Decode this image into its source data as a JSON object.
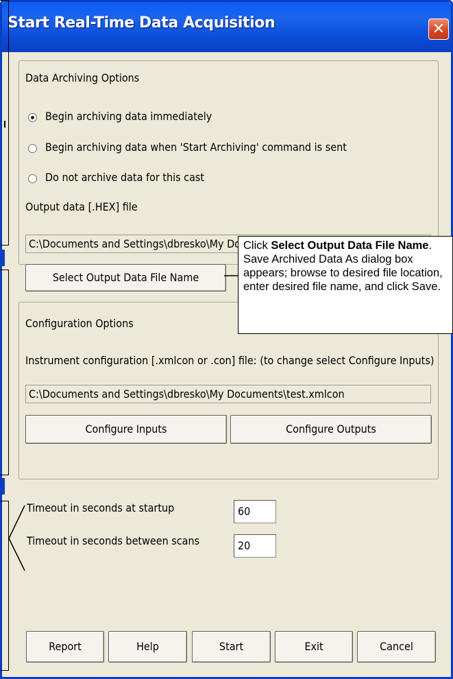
{
  "window": {
    "title": "Start Real-Time Data Acquisition",
    "close_icon": "close-icon"
  },
  "archiving": {
    "group_label": "Data Archiving Options",
    "options": [
      {
        "label": "Begin archiving data immediately",
        "selected": true
      },
      {
        "label": "Begin archiving data when 'Start Archiving' command is sent",
        "selected": false
      },
      {
        "label": "Do not archive data for this cast",
        "selected": false
      }
    ],
    "output_label": "Output data [.HEX] file",
    "output_path": "C:\\Documents and Settings\\dbresko\\My Documents\\test.hex",
    "select_button": "Select Output Data File Name"
  },
  "configuration": {
    "group_label": "Configuration Options",
    "instrument_label": "Instrument configuration [.xmlcon or .con] file: (to change select Configure Inputs)",
    "instrument_path": "C:\\Documents and Settings\\dbresko\\My Documents\\test.xmlcon",
    "configure_inputs": "Configure Inputs",
    "configure_outputs": "Configure Outputs"
  },
  "timeouts": {
    "startup_label": "Timeout in seconds at startup",
    "startup_value": "60",
    "scans_label": "Timeout in seconds between scans",
    "scans_value": "20"
  },
  "buttons": {
    "report": "Report",
    "help": "Help",
    "start": "Start",
    "exit": "Exit",
    "cancel": "Cancel"
  },
  "callout": {
    "prefix": "Click ",
    "bold": "Select Output Data File Name",
    "rest": ". Save Archived Data As dialog box appears; browse to desired file location, enter desired file name, and click Save."
  },
  "colors": {
    "title_bar": "#0a4ad6",
    "dialog_bg": "#ece9d8",
    "close_button": "#d5441f"
  }
}
